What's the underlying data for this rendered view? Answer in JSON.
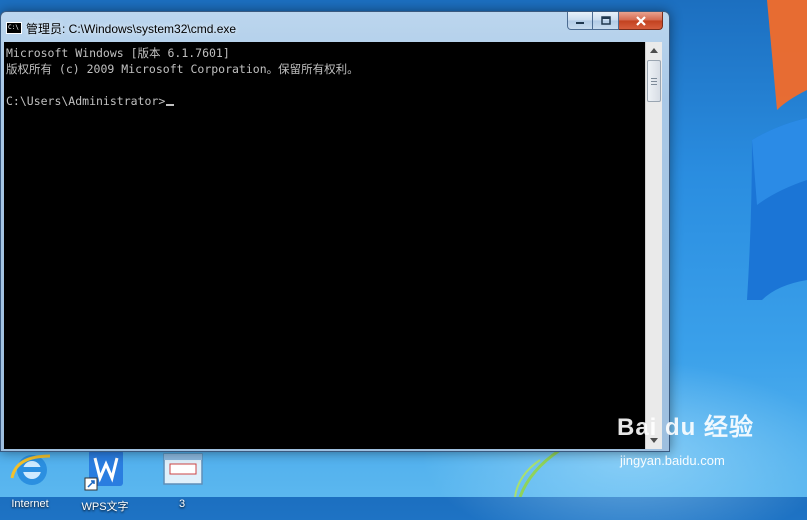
{
  "window": {
    "title": "管理员: C:\\Windows\\system32\\cmd.exe",
    "icon": "cmd-icon",
    "buttons": [
      "minimize-icon",
      "maximize-icon",
      "close-icon"
    ]
  },
  "console": {
    "lines": [
      "Microsoft Windows [版本 6.1.7601]",
      "版权所有 (c) 2009 Microsoft Corporation。保留所有权利。",
      "",
      "C:\\Users\\Administrator>"
    ]
  },
  "desktop": {
    "icons": [
      {
        "label": "Internet",
        "icon": "internet-explorer-icon"
      },
      {
        "label": "WPS文字",
        "icon": "wps-writer-icon"
      },
      {
        "label": "3",
        "icon": "shortcut-window-icon"
      }
    ]
  },
  "watermark": {
    "brand": "Bai du 经验",
    "url": "jingyan.baidu.com"
  },
  "colors": {
    "console_bg": "#000000",
    "console_fg": "#c0c0c0",
    "titlebar": "#a9c8e6",
    "desktop": "#2a8de0",
    "close_button": "#c2411f"
  }
}
